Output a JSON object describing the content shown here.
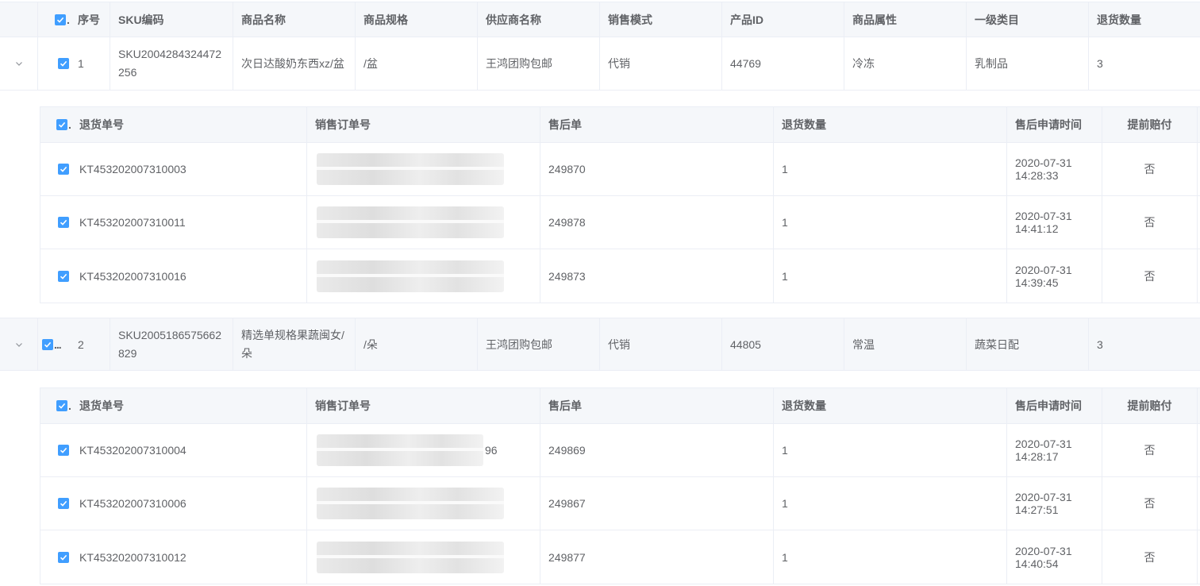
{
  "outer_columns": {
    "index": "序号",
    "sku": "SKU编码",
    "name": "商品名称",
    "spec": "商品规格",
    "supplier": "供应商名称",
    "mode": "销售模式",
    "pid": "产品ID",
    "attr": "商品属性",
    "category": "一级类目",
    "qty": "退货数量"
  },
  "inner_columns": {
    "return_no": "退货单号",
    "order_no": "销售订单号",
    "after_sale": "售后单",
    "qty": "退货数量",
    "apply_time": "售后申请时间",
    "advance_pay": "提前赔付"
  },
  "colors": {
    "checkbox": "#409eff",
    "header_bg": "#f5f7fa",
    "border": "#ebeef5",
    "text": "#606266"
  },
  "products": [
    {
      "index": "1",
      "sku": "SKU2004284324472256",
      "name": "次日达酸奶东西xz/盆",
      "spec": "/盆",
      "supplier": "王鸿团购包邮",
      "mode": "代销",
      "pid": "44769",
      "attr": "冷冻",
      "category": "乳制品",
      "qty": "3",
      "returns": [
        {
          "return_no": "KT453202007310003",
          "order_tail": "",
          "after_sale": "249870",
          "qty": "1",
          "apply_time": "2020-07-31 14:28:33",
          "advance_pay": "否"
        },
        {
          "return_no": "KT453202007310011",
          "order_tail": "",
          "after_sale": "249878",
          "qty": "1",
          "apply_time": "2020-07-31 14:41:12",
          "advance_pay": "否"
        },
        {
          "return_no": "KT453202007310016",
          "order_tail": "",
          "after_sale": "249873",
          "qty": "1",
          "apply_time": "2020-07-31 14:39:45",
          "advance_pay": "否"
        }
      ]
    },
    {
      "index": "2",
      "sku": "SKU2005186575662829",
      "name": "精选单规格果蔬闽女/朵",
      "spec": "/朵",
      "supplier": "王鸿团购包邮",
      "mode": "代销",
      "pid": "44805",
      "attr": "常温",
      "category": "蔬菜日配",
      "qty": "3",
      "returns": [
        {
          "return_no": "KT453202007310004",
          "order_tail": "96",
          "after_sale": "249869",
          "qty": "1",
          "apply_time": "2020-07-31 14:28:17",
          "advance_pay": "否"
        },
        {
          "return_no": "KT453202007310006",
          "order_tail": "",
          "after_sale": "249867",
          "qty": "1",
          "apply_time": "2020-07-31 14:27:51",
          "advance_pay": "否"
        },
        {
          "return_no": "KT453202007310012",
          "order_tail": "",
          "after_sale": "249877",
          "qty": "1",
          "apply_time": "2020-07-31 14:40:54",
          "advance_pay": "否"
        }
      ]
    }
  ]
}
